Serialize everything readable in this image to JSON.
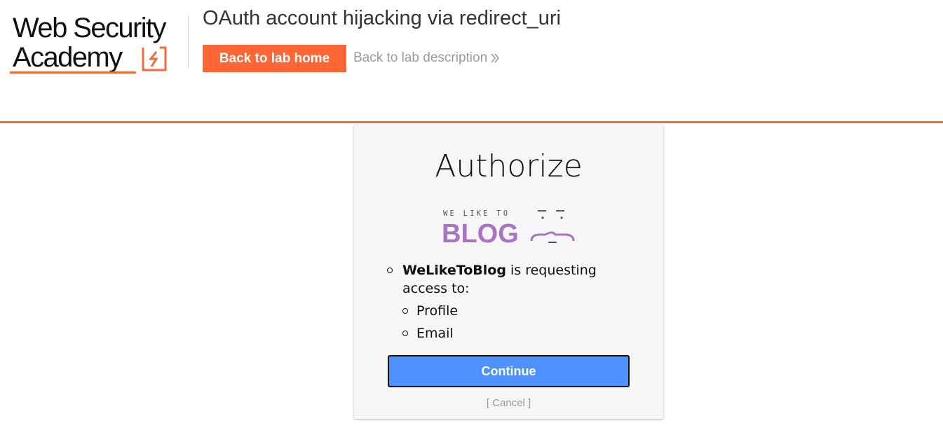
{
  "header": {
    "logo_line1": "Web Security",
    "logo_line2": "Academy",
    "lab_title": "OAuth account hijacking via redirect_uri",
    "back_home_label": "Back to lab home",
    "back_description_label": "Back to lab description",
    "accent_color": "#ff6633"
  },
  "auth": {
    "title": "Authorize",
    "blog_logo_small": "WE LIKE TO",
    "blog_logo_big": "BLOG",
    "blog_color": "#a774c4",
    "app_name": "WeLikeToBlog",
    "request_text": " is requesting access to:",
    "scopes": [
      "Profile",
      "Email"
    ],
    "continue_label": "Continue",
    "cancel_label": "[ Cancel ]",
    "button_color": "#4d90fe"
  }
}
